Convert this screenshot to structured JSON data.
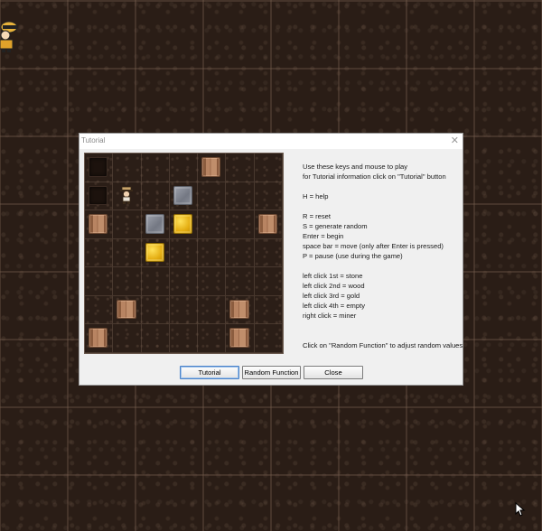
{
  "window": {
    "title": "Tutorial",
    "close_glyph": "✕"
  },
  "board": {
    "rows": 7,
    "cols": 7,
    "cells": [
      [
        "dark",
        "empty",
        "empty",
        "empty",
        "wood",
        "empty",
        "empty"
      ],
      [
        "dark",
        "miner",
        "empty",
        "stone",
        "empty",
        "empty",
        "empty"
      ],
      [
        "wood",
        "empty",
        "stone",
        "gold",
        "empty",
        "empty",
        "wood"
      ],
      [
        "empty",
        "empty",
        "gold",
        "empty",
        "empty",
        "empty",
        "empty"
      ],
      [
        "empty",
        "empty",
        "empty",
        "empty",
        "empty",
        "empty",
        "empty"
      ],
      [
        "empty",
        "wood",
        "empty",
        "empty",
        "empty",
        "wood",
        "empty"
      ],
      [
        "wood",
        "empty",
        "empty",
        "empty",
        "empty",
        "wood",
        "empty"
      ]
    ]
  },
  "help": {
    "lines": [
      "Use these keys and mouse to play",
      "for Tutorial information click on \"Tutorial\" button",
      "",
      "H = help",
      "",
      "R = reset",
      "S = generate random",
      "Enter = begin",
      "space bar = move (only after Enter is pressed)",
      "P = pause (use during the game)",
      "",
      "left click 1st = stone",
      "left click 2nd = wood",
      "left click 3rd = gold",
      "left click 4th = empty",
      "right click = miner",
      "",
      "",
      "Click on \"Random Function\" to adjust random values"
    ]
  },
  "buttons": {
    "tutorial": "Tutorial",
    "random_function": "Random Function",
    "close": "Close"
  },
  "icons": {
    "corner": "miner-icon",
    "cursor": "mouse-pointer-icon"
  },
  "colors": {
    "background": "#2a1d16",
    "dialog": "#f0f0f0",
    "gold": "#e4ad12",
    "wood": "#b88462",
    "stone": "#8b8f99"
  }
}
